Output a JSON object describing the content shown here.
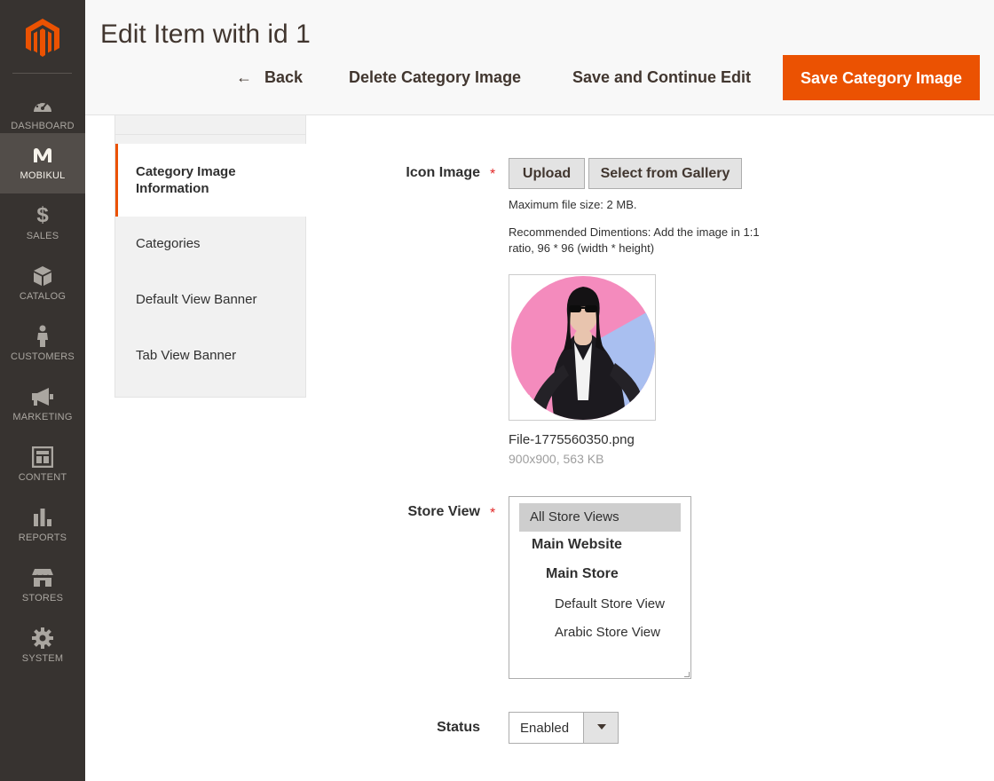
{
  "nav": {
    "items": [
      {
        "label": "DASHBOARD",
        "icon": "dashboard-icon"
      },
      {
        "label": "MOBIKUL",
        "icon": "mobikul-icon",
        "active": true
      },
      {
        "label": "SALES",
        "icon": "dollar-icon"
      },
      {
        "label": "CATALOG",
        "icon": "box-icon"
      },
      {
        "label": "CUSTOMERS",
        "icon": "person-icon"
      },
      {
        "label": "MARKETING",
        "icon": "megaphone-icon"
      },
      {
        "label": "CONTENT",
        "icon": "layout-icon"
      },
      {
        "label": "REPORTS",
        "icon": "bar-chart-icon"
      },
      {
        "label": "STORES",
        "icon": "storefront-icon"
      },
      {
        "label": "SYSTEM",
        "icon": "gear-icon"
      }
    ]
  },
  "header": {
    "title": "Edit Item with id 1",
    "back_label": "Back",
    "delete_label": "Delete Category Image",
    "save_continue_label": "Save and Continue Edit",
    "save_label": "Save Category Image"
  },
  "tabs": {
    "info": "Category Image Information",
    "categories": "Categories",
    "default_banner": "Default View Banner",
    "tab_banner": "Tab View Banner"
  },
  "form": {
    "icon_image": {
      "label": "Icon Image",
      "required_mark": "*",
      "upload_label": "Upload",
      "gallery_label": "Select from Gallery",
      "max_size_note": "Maximum file size: 2 MB.",
      "recommend_note": "Recommended Dimentions: Add the image in 1:1 ratio, 96 * 96 (width * height)",
      "file_name": "File-1775560350.png",
      "file_meta": "900x900, 563 KB"
    },
    "store_view": {
      "label": "Store View",
      "required_mark": "*",
      "options": [
        "All Store Views",
        "Main Website",
        "Main Store",
        "Default Store View",
        "Arabic Store View"
      ],
      "selected": "All Store Views"
    },
    "status": {
      "label": "Status",
      "value": "Enabled"
    }
  },
  "colors": {
    "accent": "#eb5202",
    "nav_bg": "#373330",
    "nav_active": "#524d49"
  }
}
